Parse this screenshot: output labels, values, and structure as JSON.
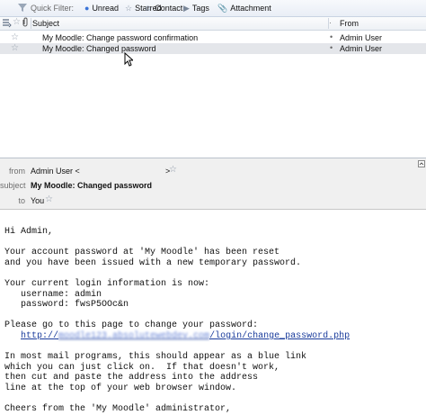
{
  "quick_filter": {
    "label": "Quick Filter:",
    "buttons": [
      {
        "label": "Unread",
        "icon": "unread-dot-icon"
      },
      {
        "label": "Starred",
        "icon": "star-icon"
      },
      {
        "label": "Contact",
        "icon": "contact-icon"
      },
      {
        "label": "Tags",
        "icon": "tag-icon"
      },
      {
        "label": "Attachment",
        "icon": "paperclip-icon"
      }
    ]
  },
  "columns": {
    "subject": "Subject",
    "from": "From"
  },
  "messages": [
    {
      "subject": "My Moodle: Change password confirmation",
      "from": "Admin User",
      "selected": false
    },
    {
      "subject": "My Moodle: Changed password",
      "from": "Admin User",
      "selected": true
    }
  ],
  "header": {
    "from_label": "from",
    "from_value": "Admin User <",
    "from_tail": ">",
    "subject_label": "subject",
    "subject_value": "My Moodle: Changed password",
    "to_label": "to",
    "to_value": "You"
  },
  "body": {
    "greeting": "Hi Admin,",
    "p1_line1": "Your account password at 'My Moodle' has been reset",
    "p1_line2": "and you have been issued with a new temporary password.",
    "p2_line1": "Your current login information is now:",
    "username_line": "   username: admin",
    "password_line": "   password: fwsP5OOc&n",
    "p3_line1": "Please go to this page to change your password:",
    "link_prefix": "http://",
    "link_hidden": "moodle123.absolutewebdev.com",
    "link_suffix": "/login/change_password.php",
    "p4_line1": "In most mail programs, this should appear as a blue link",
    "p4_line2": "which you can just click on.  If that doesn't work,",
    "p4_line3": "then cut and paste the address into the address",
    "p4_line4": "line at the top of your web browser window.",
    "closing": "Cheers from the 'My Moodle' administrator,"
  },
  "colors": {
    "link": "#1a3c9c",
    "selected_row": "#e4e6ea",
    "header_bg": "#f0f0f0"
  }
}
